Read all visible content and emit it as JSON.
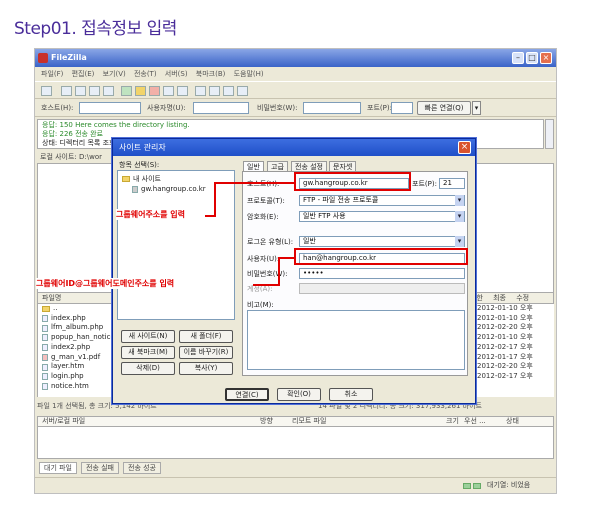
{
  "heading": "Step01. 접속정보 입력",
  "app": {
    "title": "FileZilla",
    "menu": "파일(F) 편집(E) 보기(V) 전송(T) 서버(S) 북마크(B) 도움말(H)",
    "quickconnect": {
      "host_label": "호스트(H):",
      "user_label": "사용자명(U):",
      "pass_label": "비밀번호(W):",
      "port_label": "포트(P):",
      "button": "빠른 연결(Q)"
    },
    "log": [
      {
        "kind": "응답:",
        "text": "150 Here comes the directory listing."
      },
      {
        "kind": "응답:",
        "text": "226 전송 완료"
      },
      {
        "kind": "상태:",
        "text": "디렉터리 목록 조회 성공"
      }
    ],
    "local_site_label": "로컬 사이트:",
    "local_path": "D:\\wor",
    "file_list_header": "파일명",
    "files": [
      "..",
      "index.php",
      "lfm_album.php",
      "popup_han_notice",
      "index2.php",
      "g_man_v1.pdf",
      "layer.htm",
      "login.php",
      "notice.htm"
    ],
    "right_header": "권한 최종 수정",
    "dates": [
      "",
      "2012-01-10 오후",
      "2012-01-10 오후",
      "2012-02-20 오후",
      "2012-01-10 오후",
      "2012-02-17 오후",
      "2012-01-17 오후",
      "2012-02-20 오후",
      "2012-02-17 오후"
    ],
    "status_left": "파일 1개 선택됨, 총 크기: 5,142 바이트",
    "status_right": "14 파일 및 2 디렉터리. 총 크기: 317,933,261 바이트",
    "queue_columns": [
      "서버/로컬 파일",
      "방향",
      "리모트 파일",
      "크기",
      "우선 ...",
      "상태"
    ],
    "queue_tabs": [
      "대기 파일",
      "전송 실패",
      "전송 성공"
    ],
    "bottom_status": "대기열: 비었음"
  },
  "dialog": {
    "title": "사이트 관리자",
    "tree_label": "항목 선택(S):",
    "tree_root": "내 사이트",
    "tree_item": "gw.hangroup.co.kr",
    "tabs": [
      "일반",
      "고급",
      "전송 설정",
      "문자셋"
    ],
    "fields": {
      "host_label": "호스트(H):",
      "host_value": "gw.hangroup.co.kr",
      "port_label": "포트(P):",
      "port_value": "21",
      "protocol_label": "프로토콜(T):",
      "protocol_value": "FTP - 파일 전송 프로토콜",
      "encryption_label": "암호화(E):",
      "encryption_value": "일반 FTP 사용",
      "logon_label": "로그온 유형(L):",
      "logon_value": "일반",
      "user_label": "사용자(U):",
      "user_value": "han@hangroup.co.kr",
      "pass_label": "비밀번호(W):",
      "pass_value": "•••••",
      "account_label": "계정(A):",
      "comments_label": "비고(M):"
    },
    "buttons": {
      "new_site": "새 사이트(N)",
      "new_folder": "새 폴더(F)",
      "new_bookmark": "새 북마크(M)",
      "rename": "이름 바꾸기(R)",
      "delete": "삭제(D)",
      "copy": "복사(Y)",
      "connect": "연결(C)",
      "ok": "확인(O)",
      "cancel": "취소"
    }
  },
  "callouts": {
    "host": "그룹웨어주소를 입력",
    "user": "그룹웨어ID@그룹웨어도메인주소를 입력"
  }
}
